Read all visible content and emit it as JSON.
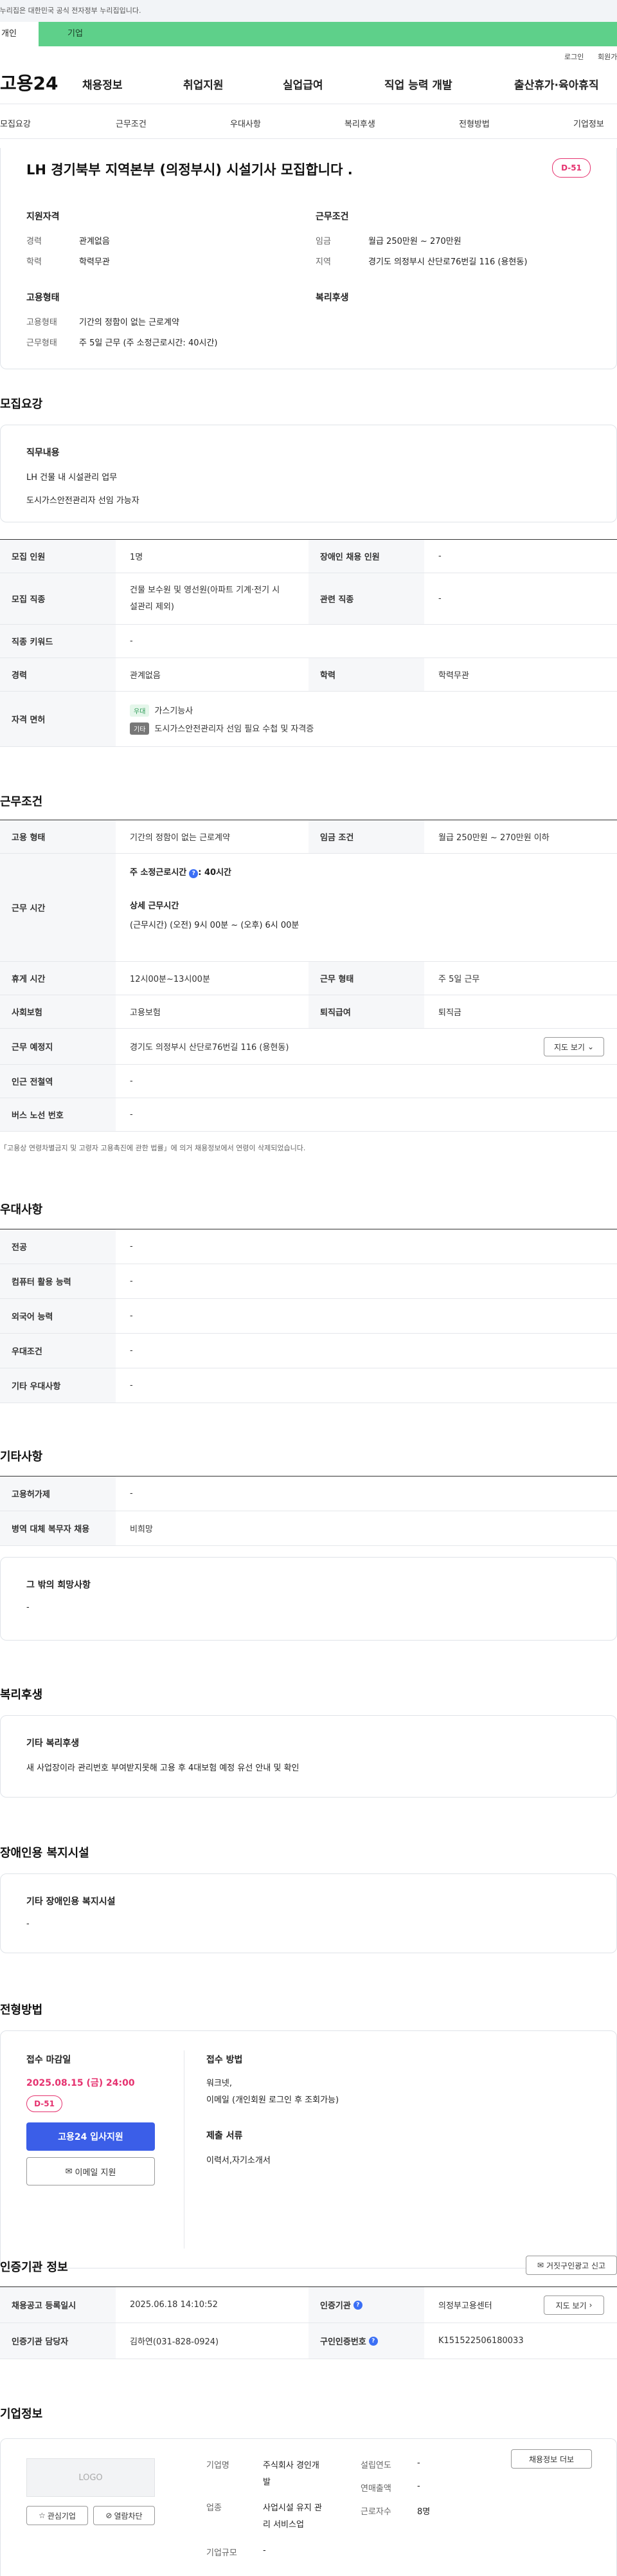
{
  "banner": "이 누리집은 대한민국 공식 전자정부 누리집입니다.",
  "topbar": {
    "tab1": "개인",
    "tab2": "기업"
  },
  "util": {
    "login": "로그인",
    "join": "회원가입"
  },
  "logo": "고용24",
  "gnb": [
    "채용정보",
    "취업지원",
    "실업급여",
    "직업 능력 개발",
    "출산휴가·육아휴직"
  ],
  "subnav": [
    "모집요강",
    "근무조건",
    "우대사항",
    "복리후생",
    "전형방법",
    "기업정보"
  ],
  "job": {
    "title": "LH 경기북부 지역본부 (의정부시) 시설기사 모집합니다 .",
    "dday": "D-51",
    "sec1": "지원자격",
    "exp_l": "경력",
    "exp_v": "관계없음",
    "edu_l": "학력",
    "edu_v": "학력무관",
    "sec2": "근무조건",
    "pay_l": "임금",
    "pay_v": "월급 250만원 ~ 270만원",
    "loc_l": "지역",
    "loc_v": "경기도 의정부시 산단로76번길 116 (용현동)",
    "sec3": "고용형태",
    "emp_l": "고용형태",
    "emp_v": "기간의 정함이 없는 근로계약",
    "wt_l": "근무형태",
    "wt_v": "주 5일 근무 (주 소정근로시간: 40시간)",
    "sec4": "복리후생"
  },
  "recruit": {
    "title": "모집요강",
    "duty_h": "직무내용",
    "duty1": "LH 건물 내 시설관리 업무",
    "duty2": "도시가스안전관리자 선임 가능자",
    "rows": {
      "cnt_l": "모집 인원",
      "cnt_v": "1명",
      "dis_l": "장애인 채용 인원",
      "dis_v": "-",
      "job_l": "모집 직종",
      "job_v1": "건물 보수원 및 영선원(아파트 기계·전기 시",
      "job_v2": "설관리 제외)",
      "rel_l": "관련 직종",
      "rel_v": "-",
      "kw_l": "직종 키워드",
      "kw_v": "-",
      "exp_l": "경력",
      "exp_v": "관계없음",
      "edu_l": "학력",
      "edu_v": "학력무관",
      "lic_l": "자격 면허",
      "lic_b1": "우대",
      "lic_v1": "가스기능사",
      "lic_b2": "기타",
      "lic_v2": "도시가스안전관리자 선임 필요 수첩 및 자격증"
    }
  },
  "cond": {
    "title": "근무조건",
    "emp_l": "고용 형태",
    "emp_v": "기간의 정함이 없는 근로계약",
    "pay_l": "임금 조건",
    "pay_v": "월급 250만원 ~ 270만원 이하",
    "hrs_l": "근무 시간",
    "hrs_v1": "주 소정근로시간",
    "hrs_v1b": ": 40시간",
    "hrs_v2": "상세 근무시간",
    "hrs_v3": "(근무시간) (오전) 9시 00분 ~ (오후) 6시 00분",
    "brk_l": "휴게 시간",
    "brk_v": "12시00분~13시00분",
    "wt_l": "근무 형태",
    "wt_v": "주 5일 근무",
    "ins_l": "사회보험",
    "ins_v": "고용보험",
    "ret_l": "퇴직급여",
    "ret_v": "퇴직금",
    "loc_l": "근무 예정지",
    "loc_v": "경기도 의정부시 산단로76번길 116 (용현동)",
    "map": "지도 보기",
    "sta_l": "인근 전철역",
    "sta_v": "-",
    "bus_l": "버스 노선 번호",
    "bus_v": "-",
    "note": "「고용상 연령차별금지 및 고령자 고용촉진에 관한 법률」에 의거 채용정보에서 연령이 삭제되었습니다."
  },
  "pref": {
    "title": "우대사항",
    "rows": [
      [
        "전공",
        "-"
      ],
      [
        "컴퓨터 활용 능력",
        "-"
      ],
      [
        "외국어 능력",
        "-"
      ],
      [
        "우대조건",
        "-"
      ],
      [
        "기타 우대사항",
        "-"
      ]
    ]
  },
  "etc": {
    "title": "기타사항",
    "rows": [
      [
        "고용허가제",
        "-"
      ],
      [
        "병역 대체 복무자 채용",
        "비희망"
      ]
    ],
    "box_h": "그 밖의 희망사항",
    "box_v": "-"
  },
  "welfare": {
    "title": "복리후생",
    "h": "기타 복리후생",
    "v": "새 사업장이라 관리번호 부여받지못해 고용 후 4대보험 예정 유선 안내 및 확인"
  },
  "disab": {
    "title": "장애인용 복지시설",
    "h": "기타 장애인용 복지시설",
    "v": "-"
  },
  "apply": {
    "title": "전형방법",
    "dl_h": "접수 마감일",
    "dl_v": "2025.08.15 (금) 24:00",
    "dday": "D-51",
    "btn1": "고용24 입사지원",
    "btn2": "이메일 지원",
    "m_h": "접수 방법",
    "m_v1": "워크넷,",
    "m_v2": "이메일 (개인회원 로그인 후 조회가능)",
    "doc_h": "제출 서류",
    "doc_v": "이력서,자기소개서"
  },
  "cert": {
    "title": "인증기관 정보",
    "report": "거짓구인광고 신고",
    "reg_l": "채용공고 등록일시",
    "reg_v": "2025.06.18 14:10:52",
    "org_l": "인증기관",
    "org_v": "의정부고용센터",
    "map": "지도 보기",
    "mgr_l": "인증기관 담당자",
    "mgr_v": "김하연(031-828-0924)",
    "no_l": "구인인증번호",
    "no_v": "K151522506180033"
  },
  "comp": {
    "title": "기업정보",
    "logo": "LOGO",
    "fav": "관심기업",
    "block": "열람차단",
    "info_btn": "채용정보 더보",
    "name_l": "기업명",
    "name_v1": "주식회사 경인개",
    "name_v2": "발",
    "year_l": "설립연도",
    "year_v": "-",
    "sales_l": "연매출액",
    "sales_v": "-",
    "ind_l": "업종",
    "ind_v1": "사업시설 유지 관",
    "ind_v2": "리 서비스업",
    "emp_l": "근로자수",
    "emp_v": "8명",
    "size_l": "기업규모",
    "size_v": "-"
  }
}
